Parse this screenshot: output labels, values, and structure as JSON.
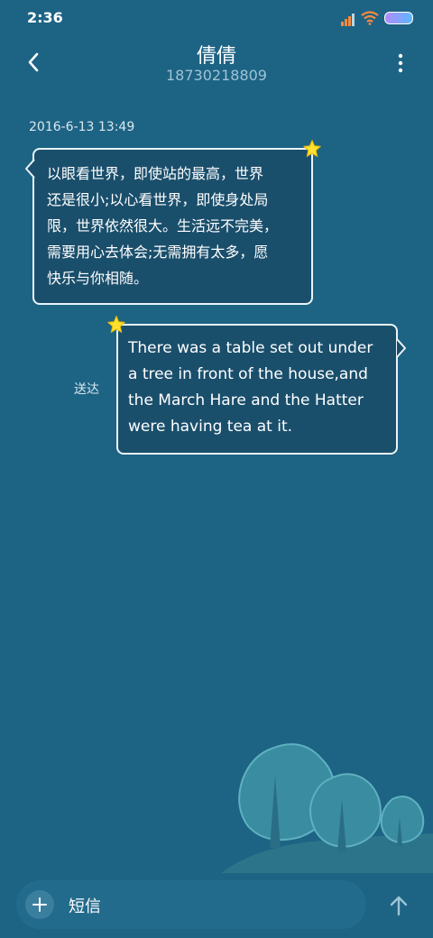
{
  "status_bar": {
    "time": "2:36",
    "icons": [
      "signal-icon",
      "wifi-icon",
      "battery-icon"
    ]
  },
  "header": {
    "contact_name": "倩倩",
    "contact_number": "18730218809",
    "icons": [
      "back-arrow-icon",
      "more-vert-icon"
    ]
  },
  "conversation": {
    "timestamp": "2016-6-13 13:49",
    "received_message": {
      "lines": [
        "以眼看世界，即使站的最高，世界",
        "还是很小;以心看世界，即使身处局",
        "限，世界依然很大。生活远不完美，",
        "需要用心去体会;无需拥有太多，愿",
        "快乐与你相随。"
      ]
    },
    "sent_message": {
      "lines": [
        "There was a table set out under",
        "a tree in front of the house,and",
        "the March Hare and the Hatter",
        "were having tea at it."
      ],
      "status": "送达"
    }
  },
  "composer": {
    "placeholder": "短信",
    "icons": [
      "add-icon",
      "send-arrow-icon"
    ]
  },
  "colors": {
    "background": "#1d6384",
    "bubble": "#1a4f6c",
    "bubble_border": "#eaf4f8",
    "star": "#ffe031",
    "tree": "#3a8ca0"
  }
}
